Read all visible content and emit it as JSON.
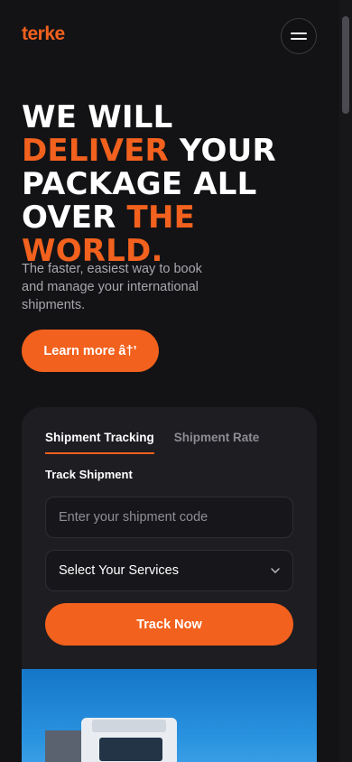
{
  "header": {
    "logo": "terke",
    "menu_icon": "hamburger-menu-icon"
  },
  "hero": {
    "title_parts": [
      "WE WILL ",
      "DELIVER",
      " YOUR PACKAGE ALL OVER ",
      "THE WORLD."
    ],
    "subtitle": "The faster, easiest way to book and manage your international shipments.",
    "cta_label": "Learn more â†’"
  },
  "tracking": {
    "tabs": [
      {
        "label": "Shipment Tracking",
        "active": true
      },
      {
        "label": "Shipment Rate",
        "active": false
      }
    ],
    "section_label": "Track Shipment",
    "code_placeholder": "Enter your shipment code",
    "code_value": "",
    "service_select": "Select Your Services",
    "submit_label": "Track Now"
  },
  "colors": {
    "accent": "#f2611d",
    "background": "#131316",
    "card": "#1d1d22"
  }
}
